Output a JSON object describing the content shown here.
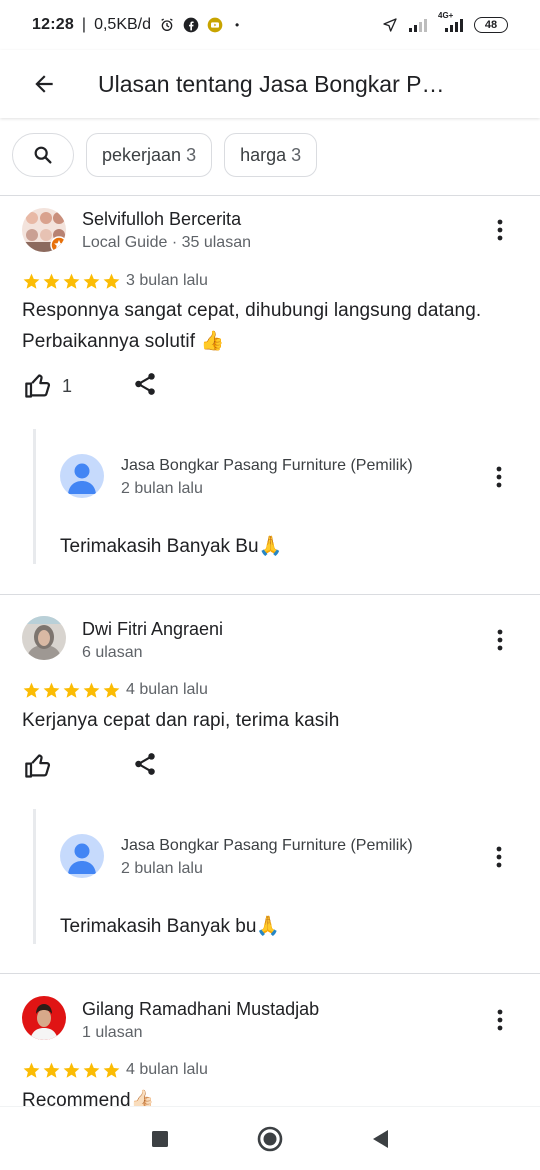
{
  "status": {
    "time": "12:28",
    "net_speed": "0,5KB/d",
    "dot": "•",
    "network": "4G+",
    "battery": "48"
  },
  "appbar": {
    "title": "Ulasan tentang Jasa Bongkar Pasang Furniture"
  },
  "chips": [
    {
      "label": "pekerjaan",
      "count": "3"
    },
    {
      "label": "harga",
      "count": "3"
    }
  ],
  "reviews": [
    {
      "name": "Selvifulloh Bercerita",
      "meta": "Local Guide · 35 ulasan",
      "rating": 5,
      "when": "3 bulan lalu",
      "text": "Responnya sangat cepat, dihubungi langsung datang. Perbaikannya solutif 👍",
      "likes": "1",
      "reply": {
        "name": "Jasa Bongkar Pasang Furniture (Pemilik)",
        "when": "2 bulan lalu",
        "text": "Terimakasih Banyak Bu🙏"
      }
    },
    {
      "name": "Dwi Fitri Angraeni",
      "meta": "6 ulasan",
      "rating": 5,
      "when": "4 bulan lalu",
      "text": "Kerjanya cepat dan rapi, terima kasih",
      "likes": "",
      "reply": {
        "name": "Jasa Bongkar Pasang Furniture (Pemilik)",
        "when": "2 bulan lalu",
        "text": "Terimakasih Banyak bu🙏"
      }
    },
    {
      "name": "Gilang Ramadhani Mustadjab",
      "meta": "1 ulasan",
      "rating": 5,
      "when": "4 bulan lalu",
      "text": "Recommend👍🏻"
    }
  ],
  "colors": {
    "star": "#fbbc04",
    "icon": "#202124",
    "reply_avatar_bg": "#c6dafc",
    "reply_avatar_fg": "#4285f4"
  }
}
